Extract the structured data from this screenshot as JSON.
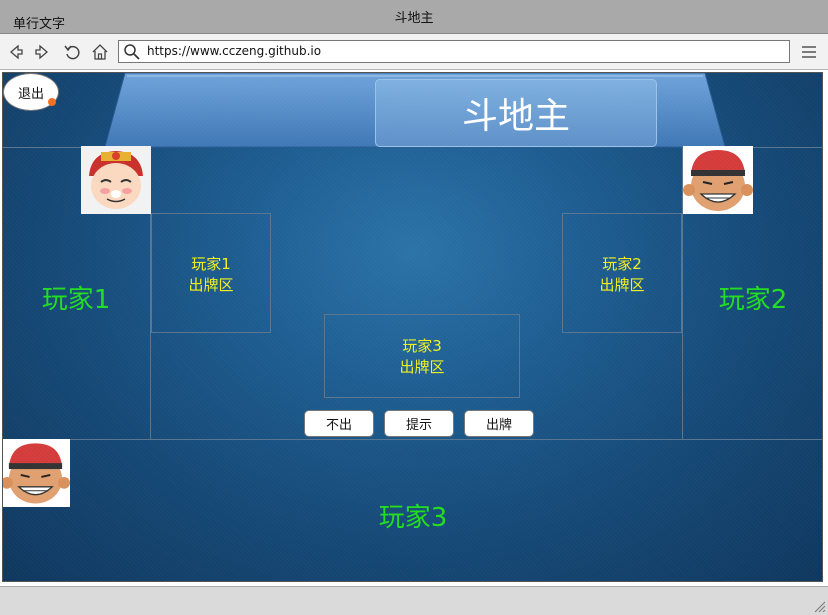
{
  "window": {
    "left_text": "单行文字",
    "title": "斗地主"
  },
  "toolbar": {
    "url": "https://www.cczeng.github.io",
    "icons": [
      "back-icon",
      "forward-icon",
      "reload-icon",
      "home-icon",
      "search-icon",
      "hamburger-menu-icon"
    ]
  },
  "game": {
    "title": "斗地主",
    "exit_label": "退出",
    "players": [
      {
        "name": "玩家1",
        "zone_line1": "玩家1",
        "zone_line2": "出牌区"
      },
      {
        "name": "玩家2",
        "zone_line1": "玩家2",
        "zone_line2": "出牌区"
      },
      {
        "name": "玩家3",
        "zone_line1": "玩家3",
        "zone_line2": "出牌区"
      }
    ],
    "buttons": {
      "pass": "不出",
      "hint": "提示",
      "play": "出牌"
    },
    "colors": {
      "player_label": "#22dd22",
      "zone_label": "#f0f020",
      "table_bg": "#1e5d91"
    }
  }
}
